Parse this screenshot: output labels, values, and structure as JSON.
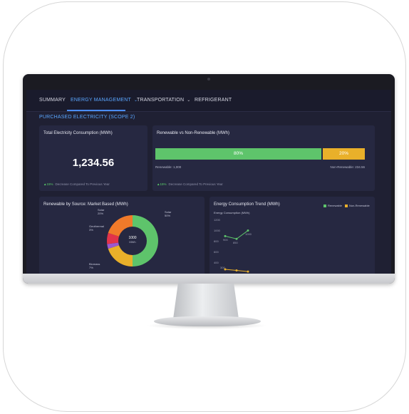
{
  "nav": {
    "tabs": [
      {
        "label": "SUMMARY"
      },
      {
        "label": "ENERGY MANAGEMENT"
      },
      {
        "label": "TRANSPORTATION"
      },
      {
        "label": "REFRIGERANT"
      }
    ]
  },
  "section_title": "PURCHASED ELECTRICITY (SCOPE 2)",
  "total_card": {
    "title": "Total Electricity Consumption (MWh)",
    "value": "1,234.56",
    "delta": "▲15%",
    "delta_text": "Decrease Compared To Previous Year"
  },
  "renewable_card": {
    "title": "Renewable vs Non-Renewable (MWh)",
    "renewable_pct": "80%",
    "nonrenewable_pct": "20%",
    "renewable_fraction": 0.8,
    "renewable_label": "Renewable: 1,000",
    "nonrenewable_label": "Non-Renewable: 234.56",
    "delta": "▲15%",
    "delta_text": "Decrease Compared To Previous Year",
    "colors": {
      "renewable": "#5ec46b",
      "nonrenewable": "#e9b02a"
    }
  },
  "source_card": {
    "title": "Renewable by Source: Market Based (MWh)",
    "center_value": "1000",
    "center_unit": "MWh",
    "labels": [
      {
        "name": "Solar",
        "pct": "20%"
      },
      {
        "name": "Geothermal",
        "pct": "3%"
      },
      {
        "name": "Biomass",
        "pct": "7%"
      },
      {
        "name": "Solar",
        "pct": "50%"
      }
    ]
  },
  "trend_card": {
    "title": "Energy Consumption Trend (MWh)",
    "subtitle": "Energy Consumption (MWh)",
    "legend": [
      {
        "name": "Renewable",
        "color": "#5ec46b"
      },
      {
        "name": "Non-Renewable",
        "color": "#e9b02a"
      }
    ],
    "y_ticks": [
      "1200",
      "1000",
      "800",
      "600",
      "400"
    ],
    "point_labels": [
      "900",
      "850",
      "1000",
      "300"
    ]
  },
  "chart_data": [
    {
      "type": "pie",
      "title": "Renewable by Source: Market Based (MWh)",
      "slices": [
        {
          "name": "Solar",
          "value": 50,
          "color": "#5ec46b"
        },
        {
          "name": "Solar",
          "value": 20,
          "color": "#e9b02a"
        },
        {
          "name": "Geothermal",
          "value": 3,
          "color": "#9b59d0"
        },
        {
          "name": "Biomass",
          "value": 7,
          "color": "#e2334a"
        },
        {
          "name": "",
          "value": 20,
          "color": "#f07a2a"
        }
      ]
    },
    {
      "type": "line",
      "title": "Energy Consumption Trend (MWh)",
      "ylabel": "Energy Consumption (MWh)",
      "ylim": [
        300,
        1200
      ],
      "series": [
        {
          "name": "Renewable",
          "color": "#5ec46b",
          "values": [
            900,
            850,
            1000
          ]
        },
        {
          "name": "Non-Renewable",
          "color": "#e9b02a",
          "values": [
            300,
            280,
            260
          ]
        }
      ]
    }
  ]
}
